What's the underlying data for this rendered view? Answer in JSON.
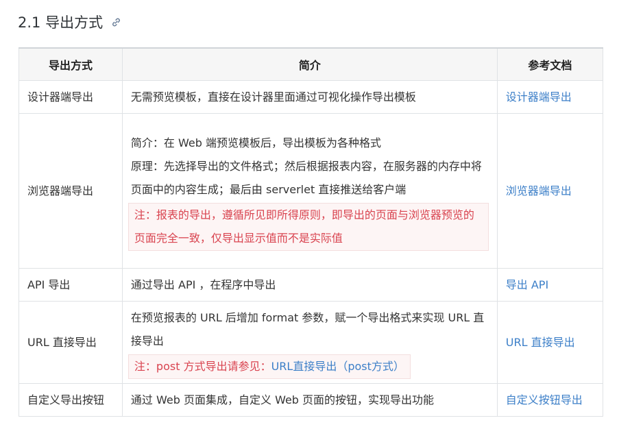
{
  "section": {
    "title": "2.1 导出方式"
  },
  "table": {
    "headers": [
      "导出方式",
      "简介",
      "参考文档"
    ],
    "rows": [
      {
        "method": "设计器端导出",
        "intro": [
          "无需预览模板，直接在设计器里面通过可视化操作导出模板"
        ],
        "doc": "设计器端导出"
      },
      {
        "method": "浏览器端导出",
        "intro": [
          "简介：在 Web 端预览模板后，导出模板为各种格式",
          "原理：先选择导出的文件格式；然后根据报表内容，在服务器的内存中将页面中的内容生成；最后由 serverlet 直接推送给客户端"
        ],
        "note": "注：报表的导出，遵循所见即所得原则，即导出的页面与浏览器预览的页面完全一致，仅导出显示值而不是实际值",
        "doc": "浏览器端导出"
      },
      {
        "method": "API 导出",
        "intro": [
          "通过导出 API ，在程序中导出"
        ],
        "doc": "导出 API"
      },
      {
        "method": "URL 直接导出",
        "intro": [
          "在预览报表的 URL 后增加 format 参数，赋一个导出格式来实现 URL 直接导出"
        ],
        "note_prefix": "注：post 方式导出请参见：",
        "note_link": "URL直接导出（post方式）",
        "doc": "URL 直接导出"
      },
      {
        "method": "自定义导出按钮",
        "intro": [
          "通过 Web 页面集成，自定义 Web 页面的按钮，实现导出功能"
        ],
        "doc": "自定义按钮导出"
      }
    ]
  }
}
